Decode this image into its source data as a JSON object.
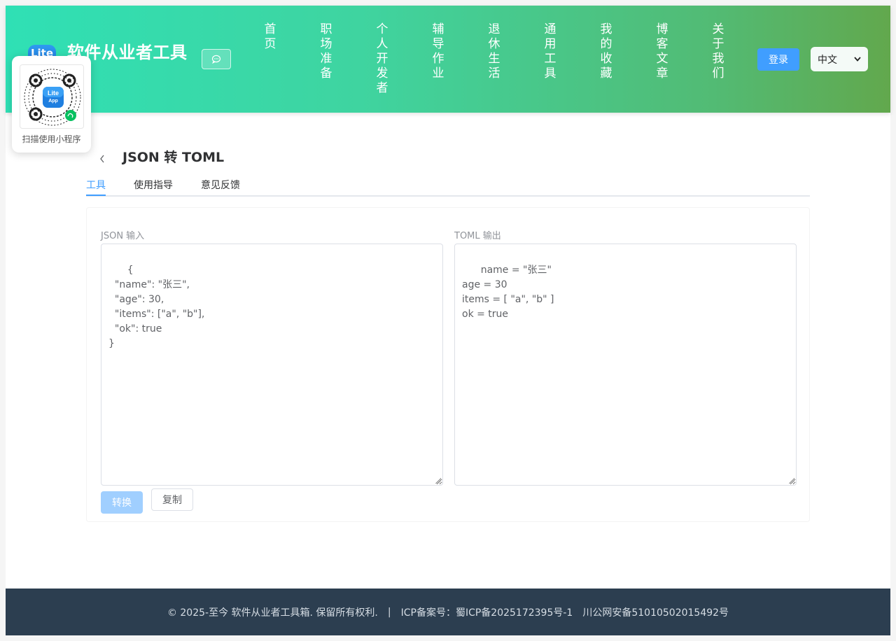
{
  "header": {
    "logo_text": "Lite",
    "site_title": "软件从业者工具",
    "nav": [
      "首页",
      "职场准备",
      "个人开发者",
      "辅导作业",
      "退休生活",
      "通用工具",
      "我的收藏",
      "博客文章",
      "关于我们"
    ],
    "login_label": "登录",
    "language": "中文"
  },
  "qr": {
    "badge_top": "Lite",
    "badge_bottom": "App",
    "caption": "扫描使用小程序"
  },
  "tool": {
    "title": "JSON 转 TOML",
    "tabs": [
      "工具",
      "使用指导",
      "意见反馈"
    ],
    "active_tab": "工具",
    "input_label": "JSON 输入",
    "output_label": "TOML 输出",
    "input_value": "{\n  \"name\": \"张三\",\n  \"age\": 30,\n  \"items\": [\"a\", \"b\"],\n  \"ok\": true\n}",
    "output_value": "name = \"张三\"\nage = 30\nitems = [ \"a\", \"b\" ]\nok = true",
    "convert_label": "转换",
    "copy_label": "复制"
  },
  "footer": {
    "copyright": "© 2025-至今 软件从业者工具箱. 保留所有权利.",
    "separator": "|",
    "icp": "ICP备案号：蜀ICP备2025172395号-1",
    "police": "川公网安备51010502015492号"
  },
  "colors": {
    "primary": "#409eff",
    "footer_bg": "#2c3e50",
    "header_gradient_start": "#2fe0b5",
    "header_gradient_end": "#62a84d"
  }
}
